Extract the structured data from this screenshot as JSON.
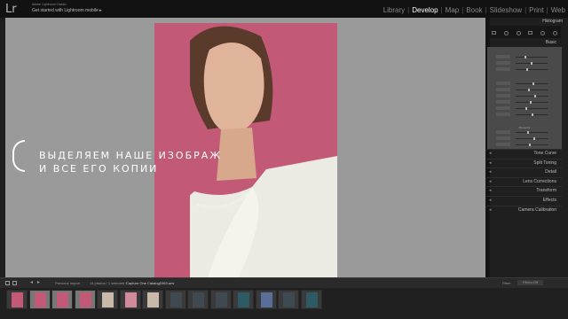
{
  "topbar": {
    "logo": "Lr",
    "product": "Adobe Lightroom Classic",
    "mobile_label": "Get started with Lightroom mobile",
    "modules": [
      {
        "label": "Library",
        "active": false
      },
      {
        "label": "Develop",
        "active": true
      },
      {
        "label": "Map",
        "active": false
      },
      {
        "label": "Book",
        "active": false
      },
      {
        "label": "Slideshow",
        "active": false
      },
      {
        "label": "Print",
        "active": false
      },
      {
        "label": "Web",
        "active": false
      }
    ]
  },
  "overlay": {
    "line1": "ВЫДЕЛЯЕМ НАШЕ ИЗОБРАЖ",
    "line2": "И ВСЕ ЕГО КОПИИ"
  },
  "right_panel": {
    "histogram": "Histogram",
    "basic": "Basic",
    "presence": "Presence",
    "panels": [
      "Tone Curve",
      "Split Toning",
      "Detail",
      "Lens Corrections",
      "Transform",
      "Effects",
      "Camera Calibration"
    ]
  },
  "filmstrip": {
    "source": "Previous Import",
    "count": "14 photos / 1 selected /",
    "filename": "Capture One Catalog0363.arw",
    "filter_label": "Filter:",
    "filter_value": "Filters Off",
    "thumbs": [
      {
        "color": "#c25a77",
        "selected": false
      },
      {
        "color": "#c25a77",
        "selected": true
      },
      {
        "color": "#c25a77",
        "selected": true
      },
      {
        "color": "#c25a77",
        "selected": true
      },
      {
        "color": "#c9b9a8",
        "selected": false
      },
      {
        "color": "#d08a9a",
        "selected": false
      },
      {
        "color": "#c9b9a8",
        "selected": false
      },
      {
        "color": "#3e4a50",
        "selected": false
      },
      {
        "color": "#3e4a50",
        "selected": false
      },
      {
        "color": "#3e4a50",
        "selected": false
      },
      {
        "color": "#2e5a66",
        "selected": false
      },
      {
        "color": "#5a6e9a",
        "selected": false
      },
      {
        "color": "#3e4a50",
        "selected": false
      },
      {
        "color": "#2e5a66",
        "selected": false
      }
    ]
  }
}
